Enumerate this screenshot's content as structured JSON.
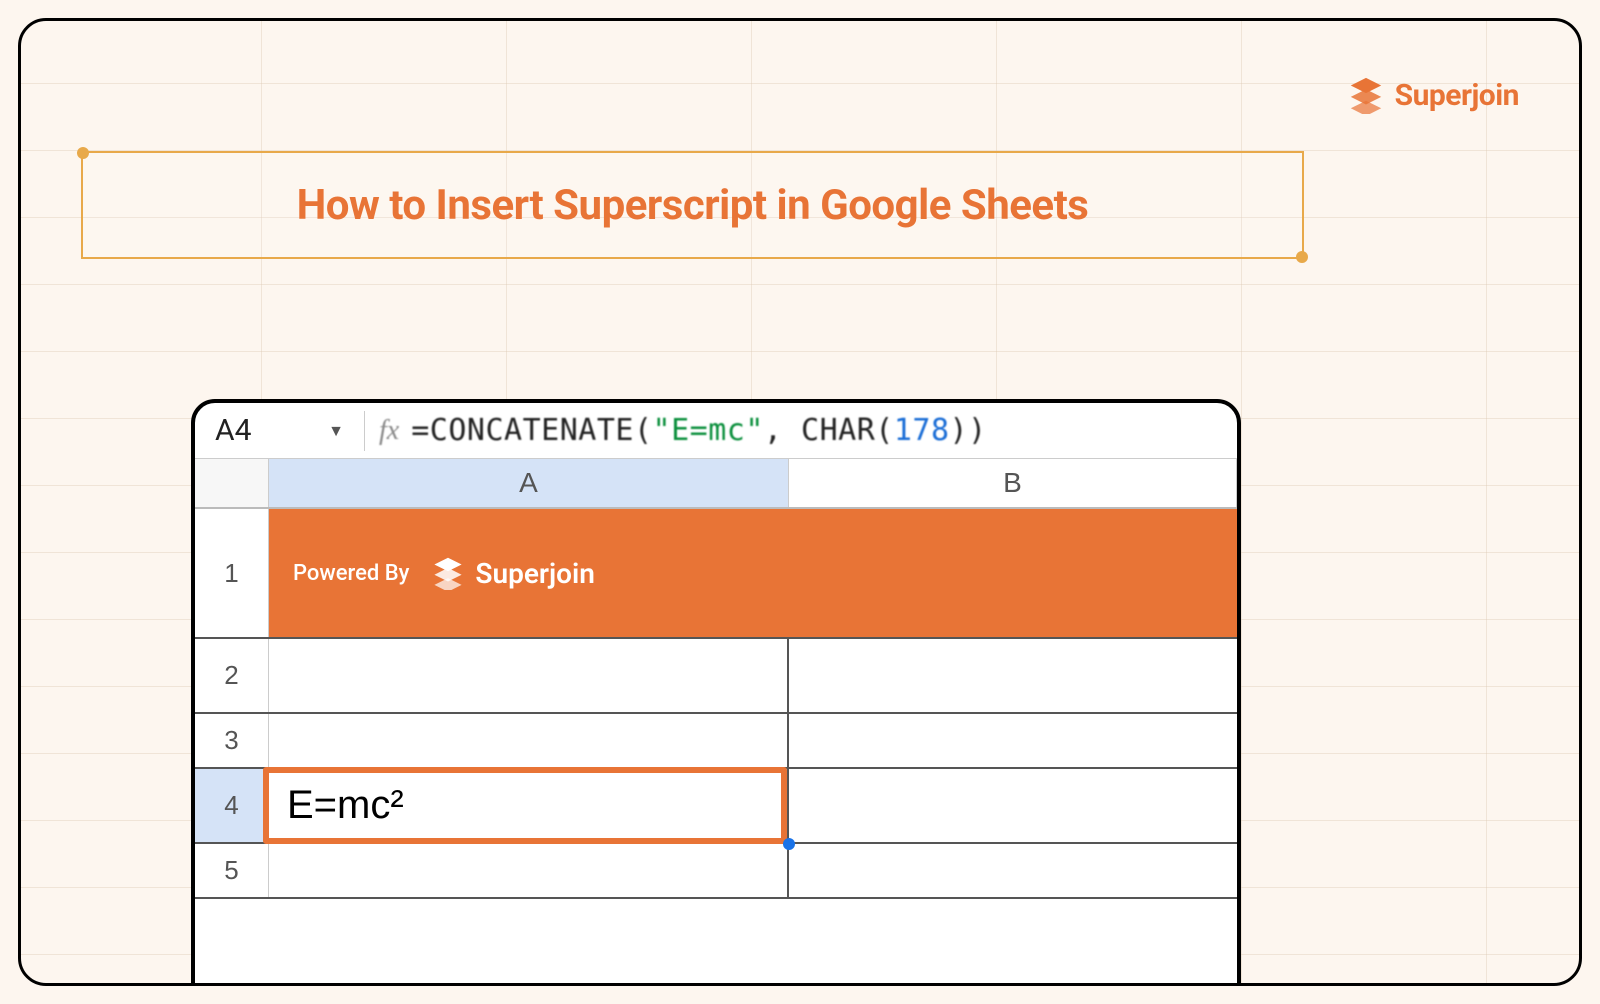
{
  "brand": {
    "name": "Superjoin"
  },
  "title": "How to Insert Superscript in Google Sheets",
  "spreadsheet": {
    "name_box": "A4",
    "formula": {
      "prefix": "=",
      "fn": "CONCATENATE",
      "open": "(",
      "arg1_str": "\"E=mc\"",
      "comma": ", ",
      "fn2": "CHAR",
      "open2": "(",
      "arg2_num": "178",
      "close2": ")",
      "close": ")"
    },
    "columns": {
      "a": "A",
      "b": "B"
    },
    "rows": {
      "r1": "1",
      "r2": "2",
      "r3": "3",
      "r4": "4",
      "r5": "5"
    },
    "banner": {
      "powered_by": "Powered By",
      "brand": "Superjoin"
    },
    "cell_a4": "E=mc²"
  }
}
